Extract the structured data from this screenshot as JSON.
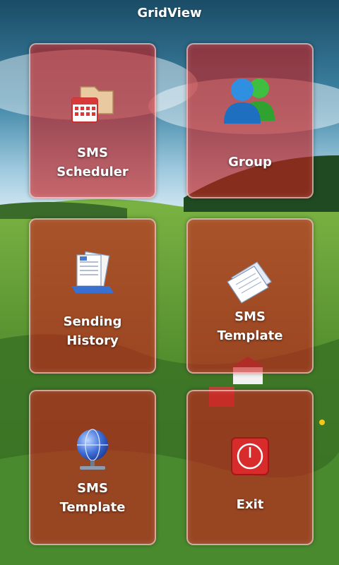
{
  "app": {
    "title": "GridView"
  },
  "tiles": [
    {
      "label": "SMS\nScheduler",
      "icon": "folder-calendar-icon"
    },
    {
      "label": "Group",
      "icon": "users-group-icon"
    },
    {
      "label": "Sending\nHistory",
      "icon": "documents-stack-icon"
    },
    {
      "label": "SMS\nTemplate",
      "icon": "paper-sheets-icon"
    },
    {
      "label": "SMS\nTemplate",
      "icon": "network-globe-icon"
    },
    {
      "label": "Exit",
      "icon": "power-icon"
    }
  ],
  "colors": {
    "tile": "#c81c1c",
    "text": "#ffffff"
  }
}
